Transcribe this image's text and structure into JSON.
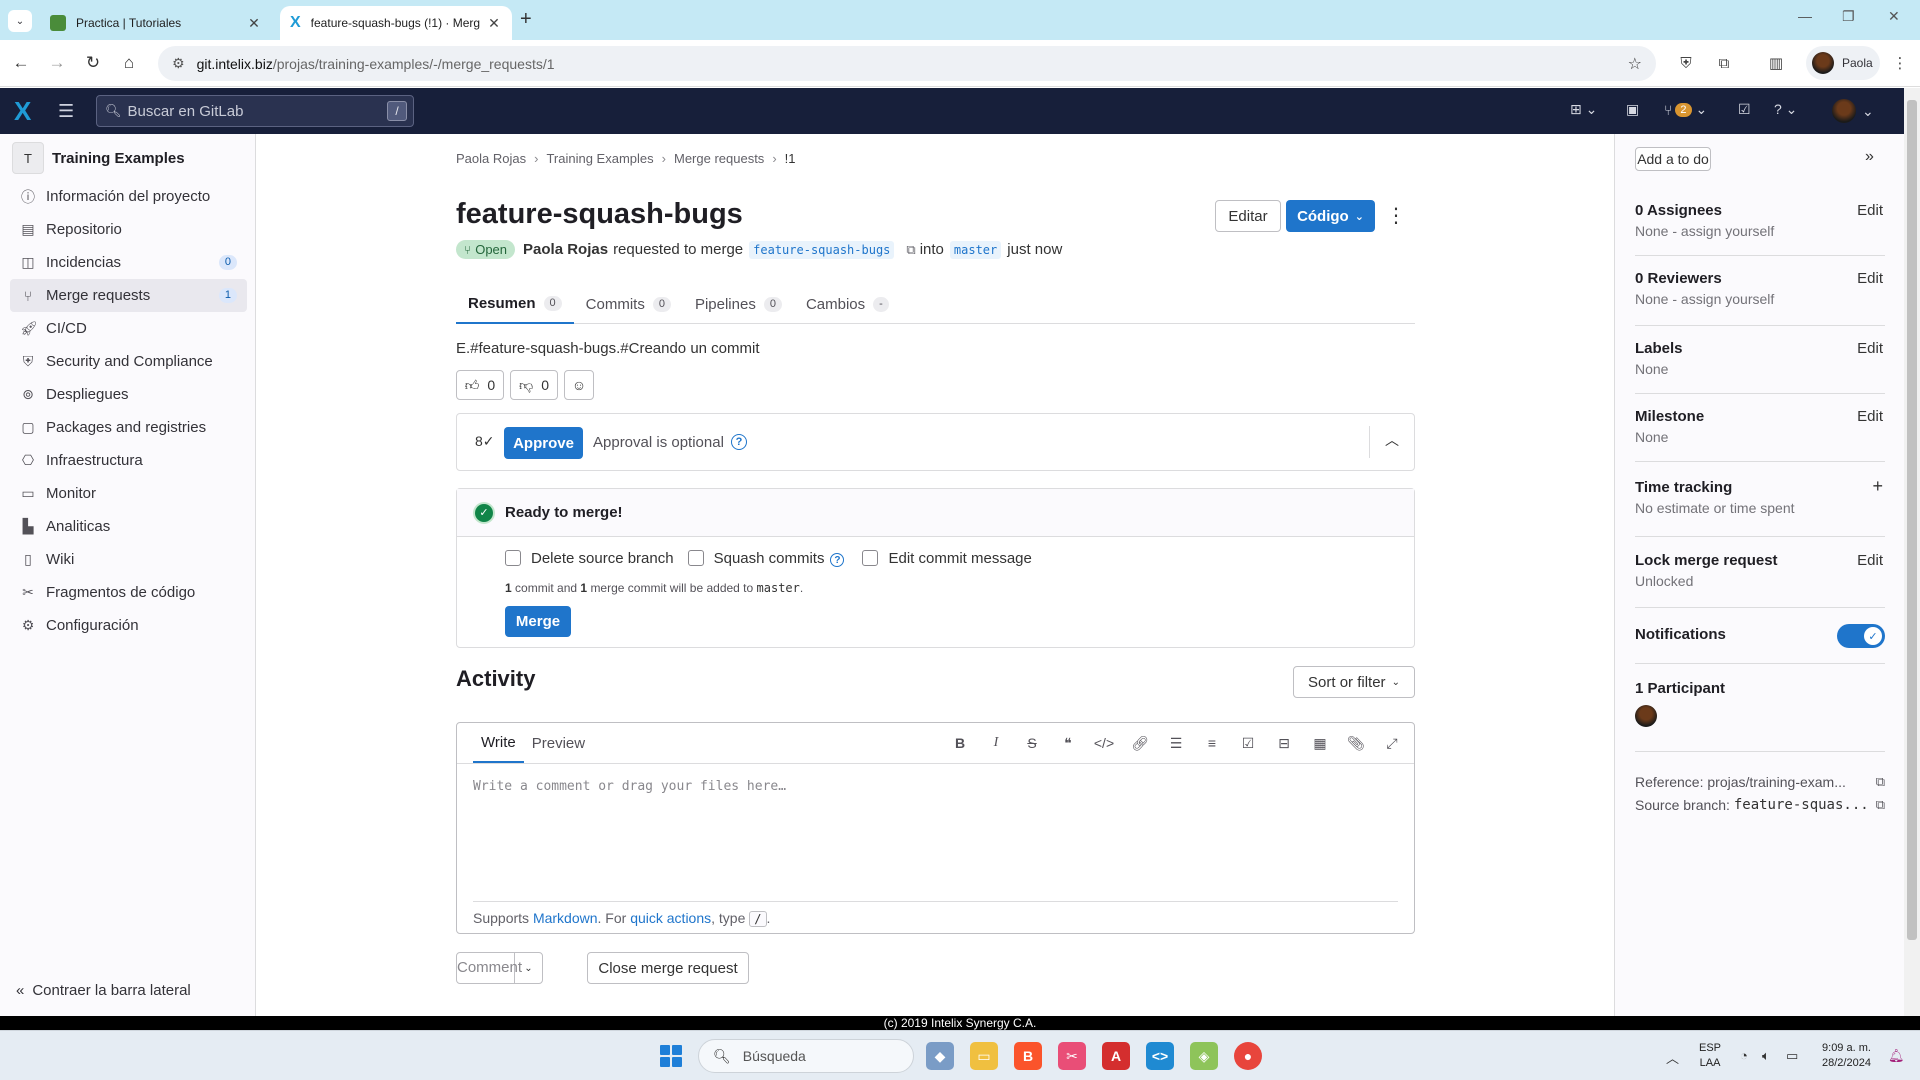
{
  "browser": {
    "tabs": [
      {
        "title": "Practica | Tutoriales",
        "active": false
      },
      {
        "title": "feature-squash-bugs (!1) · Merg",
        "active": true
      }
    ],
    "url_host": "git.intelix.biz",
    "url_path": "/projas/training-examples/-/merge_requests/1",
    "profile_name": "Paola"
  },
  "gitlab_header": {
    "search_placeholder": "Buscar en GitLab",
    "search_shortcut": "/",
    "mr_count": "2"
  },
  "sidebar": {
    "project_initial": "T",
    "project_name": "Training Examples",
    "items": [
      {
        "label": "Información del proyecto",
        "icon": "info-icon"
      },
      {
        "label": "Repositorio",
        "icon": "file-icon"
      },
      {
        "label": "Incidencias",
        "icon": "issues-icon",
        "badge": "0"
      },
      {
        "label": "Merge requests",
        "icon": "merge-request-icon",
        "badge": "1",
        "active": true
      },
      {
        "label": "CI/CD",
        "icon": "rocket-icon"
      },
      {
        "label": "Security and Compliance",
        "icon": "shield-icon"
      },
      {
        "label": "Despliegues",
        "icon": "deployments-icon"
      },
      {
        "label": "Packages and registries",
        "icon": "package-icon"
      },
      {
        "label": "Infraestructura",
        "icon": "infrastructure-icon"
      },
      {
        "label": "Monitor",
        "icon": "monitor-icon"
      },
      {
        "label": "Analiticas",
        "icon": "chart-icon"
      },
      {
        "label": "Wiki",
        "icon": "book-icon"
      },
      {
        "label": "Fragmentos de código",
        "icon": "snippet-icon"
      },
      {
        "label": "Configuración",
        "icon": "settings-icon"
      }
    ],
    "collapse_label": "Contraer la barra lateral"
  },
  "breadcrumb": [
    "Paola Rojas",
    "Training Examples",
    "Merge requests",
    "!1"
  ],
  "mr": {
    "title": "feature-squash-bugs",
    "edit_label": "Editar",
    "code_label": "Código",
    "status": "Open",
    "author": "Paola Rojas",
    "requested_text": "requested to merge",
    "source_branch": "feature-squash-bugs",
    "into_text": "into",
    "target_branch": "master",
    "time": "just now",
    "description": "E.#feature-squash-bugs.#Creando un commit"
  },
  "mr_tabs": [
    {
      "label": "Resumen",
      "count": "0",
      "active": true
    },
    {
      "label": "Commits",
      "count": "0"
    },
    {
      "label": "Pipelines",
      "count": "0"
    },
    {
      "label": "Cambios",
      "count": "-"
    }
  ],
  "reactions": {
    "thumbs_up": "0",
    "thumbs_down": "0"
  },
  "approval": {
    "approve_label": "Approve",
    "text": "Approval is optional"
  },
  "merge_widget": {
    "status": "Ready to merge!",
    "opt_delete": "Delete source branch",
    "opt_squash": "Squash commits",
    "opt_edit": "Edit commit message",
    "commits_n": "1",
    "commits_mid": "commit and",
    "merge_n": "1",
    "merge_mid": "merge commit will be added to",
    "target": "master",
    "merge_label": "Merge"
  },
  "activity": {
    "title": "Activity",
    "sort_label": "Sort or filter",
    "write_tab": "Write",
    "preview_tab": "Preview",
    "placeholder": "Write a comment or drag your files here…",
    "supports": "Supports",
    "markdown": "Markdown",
    "for_text": ". For",
    "quick_actions": "quick actions",
    "type_text": ", type",
    "slash": "/",
    "end_dot": ".",
    "comment_label": "Comment",
    "close_label": "Close merge request"
  },
  "right_sidebar": {
    "todo_label": "Add a to do",
    "assignees_title": "0 Assignees",
    "assignees_value": "None - assign yourself",
    "reviewers_title": "0 Reviewers",
    "reviewers_value": "None - assign yourself",
    "labels_title": "Labels",
    "labels_value": "None",
    "milestone_title": "Milestone",
    "milestone_value": "None",
    "time_title": "Time tracking",
    "time_value": "No estimate or time spent",
    "lock_title": "Lock merge request",
    "lock_value": "Unlocked",
    "notifications_title": "Notifications",
    "notifications_on": true,
    "participants_title": "1 Participant",
    "edit_label": "Edit",
    "reference_label": "Reference:",
    "reference_value": "projas/training-exam...",
    "source_label": "Source branch:",
    "source_value": "feature-squas..."
  },
  "footer": "(c) 2019 Intelix Synergy C.A.",
  "taskbar": {
    "search_label": "Búsqueda",
    "lang_top": "ESP",
    "lang_bottom": "LAA",
    "time": "9:09 a. m.",
    "date": "28/2/2024"
  },
  "colors": {
    "accent": "#1f75cb",
    "header": "#171f3a",
    "success": "#108548"
  }
}
